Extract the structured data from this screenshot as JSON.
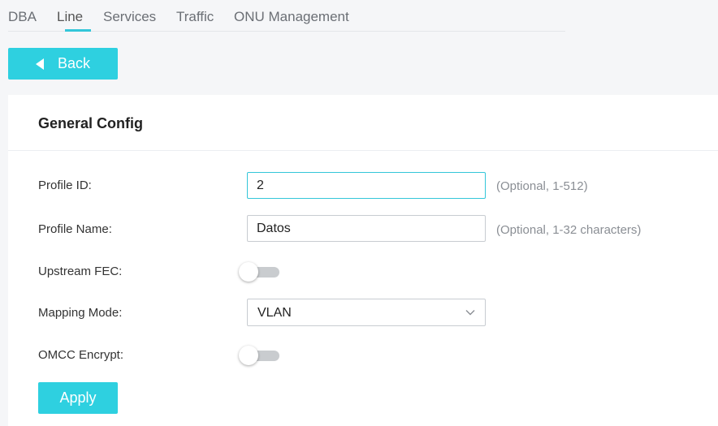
{
  "tabs": [
    {
      "label": "DBA"
    },
    {
      "label": "Line"
    },
    {
      "label": "Services"
    },
    {
      "label": "Traffic"
    },
    {
      "label": "ONU Management"
    }
  ],
  "active_tab": "Line",
  "back_button": {
    "label": "Back"
  },
  "panel": {
    "title": "General Config"
  },
  "form": {
    "profile_id": {
      "label": "Profile ID:",
      "value": "2",
      "hint": "(Optional, 1-512)"
    },
    "profile_name": {
      "label": "Profile Name:",
      "value": "Datos",
      "hint": "(Optional, 1-32 characters)"
    },
    "upstream_fec": {
      "label": "Upstream FEC:",
      "enabled": false
    },
    "mapping_mode": {
      "label": "Mapping Mode:",
      "value": "VLAN"
    },
    "omcc_encrypt": {
      "label": "OMCC Encrypt:",
      "enabled": false
    }
  },
  "apply_button": {
    "label": "Apply"
  },
  "colors": {
    "accent": "#2ed0e0",
    "tab_underline": "#33c6d9",
    "toggle_off": "#c9cccf"
  }
}
